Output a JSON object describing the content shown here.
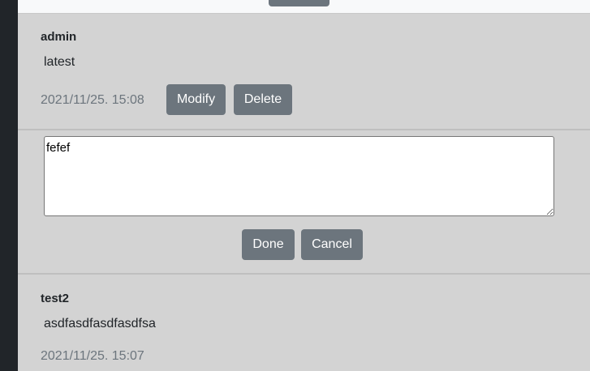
{
  "comments": [
    {
      "author": "admin",
      "content": "latest",
      "timestamp": "2021/11/25. 15:08",
      "modify_label": "Modify",
      "delete_label": "Delete"
    },
    {
      "author": "test2",
      "content": "asdfasdfasdfasdfsa",
      "timestamp": "2021/11/25. 15:07"
    }
  ],
  "edit_form": {
    "value": "fefef",
    "done_label": "Done",
    "cancel_label": "Cancel"
  },
  "colors": {
    "page_background": "#212529",
    "panel_background": "#d3d3d3",
    "button": "#6c757d",
    "timestamp_text": "#6c757d"
  }
}
